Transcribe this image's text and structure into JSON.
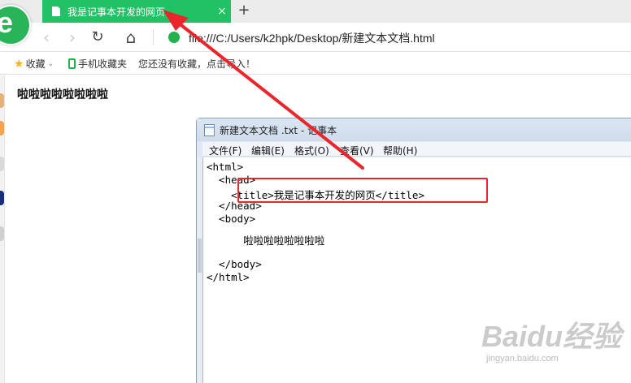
{
  "browser": {
    "tab_title": "我是记事本开发的网页",
    "tab_close": "×",
    "new_tab": "+",
    "address": "file:///C:/Users/k2hpk/Desktop/新建文本文档.html",
    "nav_icons": [
      "back-icon",
      "forward-icon",
      "reload-icon",
      "home-icon"
    ],
    "accent_color": "#21c266"
  },
  "bookmarks": {
    "favorites_label": "收藏",
    "mobile_label": "手机收藏夹",
    "hint": "您还没有收藏，点击导入！"
  },
  "page": {
    "body_text": "啦啦啦啦啦啦啦啦"
  },
  "notepad": {
    "title": "新建文本文档 .txt - 记事本",
    "menu": [
      "文件(F)",
      "编辑(E)",
      "格式(O)",
      "查看(V)",
      "帮助(H)"
    ],
    "lines": [
      "<html>",
      "  <head>",
      "    <title>我是记事本开发的网页</title>",
      "  </head>",
      "  <body>",
      "      啦啦啦啦啦啦啦啦",
      "  </body>",
      "</html>"
    ]
  },
  "annotation_color": "#e8262c",
  "watermark": {
    "logo": "Baidu经验",
    "url": "jingyan.baidu.com"
  }
}
